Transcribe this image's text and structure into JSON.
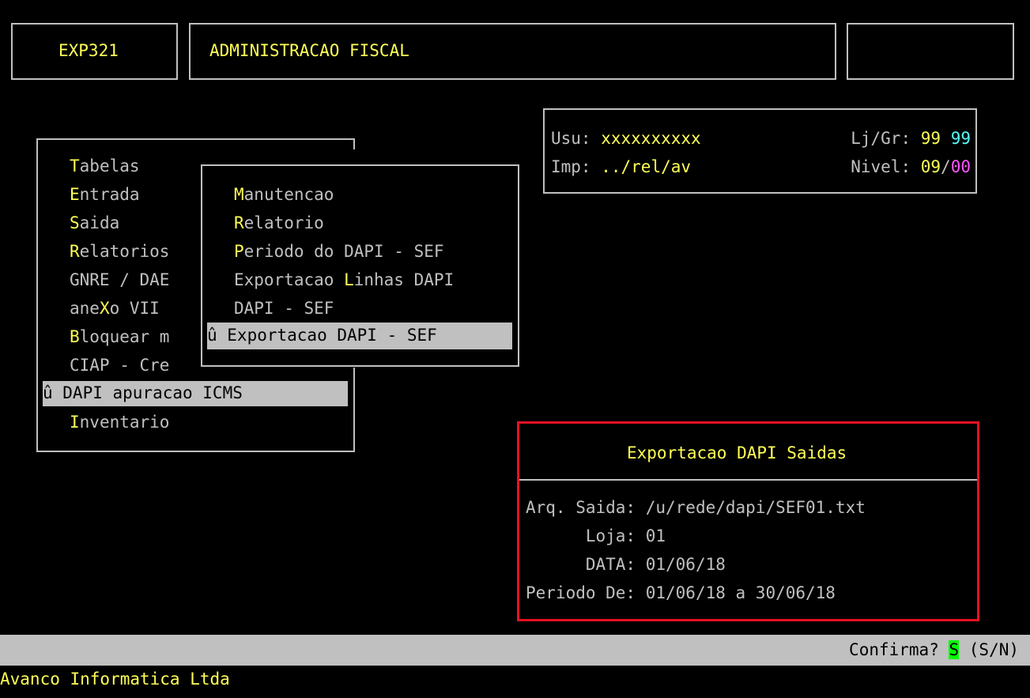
{
  "header": {
    "program_code": "EXP321",
    "title": "ADMINISTRACAO FISCAL",
    "right_box": ""
  },
  "user_info": {
    "usu_label": "Usu:",
    "usu_value": "xxxxxxxxxx",
    "lj_label": "Lj/Gr:",
    "lj_value": "99",
    "gr_value": "99",
    "imp_label": "Imp:",
    "imp_value": "../rel/av",
    "nivel_label": "Nivel:",
    "nivel_value_1": "09",
    "nivel_sep": "/",
    "nivel_value_2": "00"
  },
  "main_menu": {
    "items": [
      {
        "hot": "T",
        "rest": "abelas"
      },
      {
        "hot": "E",
        "rest": "ntrada"
      },
      {
        "hot": "S",
        "rest": "aida"
      },
      {
        "hot": "R",
        "rest": "elatorios"
      },
      {
        "pre": "GNRE / DAE",
        "hot": "",
        "rest": ""
      },
      {
        "pre": "ane",
        "hot": "X",
        "rest": "o VII"
      },
      {
        "hot": "B",
        "rest": "loquear m"
      },
      {
        "pre": "CIAP - Cre",
        "hot": "",
        "rest": ""
      },
      {
        "selected": true,
        "text": "û DAPI apuracao ICMS"
      },
      {
        "hot": "I",
        "rest": "nventario"
      }
    ]
  },
  "sub_menu": {
    "items": [
      {
        "hot": "M",
        "rest": "anutencao"
      },
      {
        "hot": "R",
        "rest": "elatorio"
      },
      {
        "hot": "P",
        "rest": "eriodo do DAPI - SEF"
      },
      {
        "pre": "Exportacao ",
        "hot": "L",
        "rest": "inhas DAPI"
      },
      {
        "pre": "DAPI - SEF",
        "hot": "",
        "rest": ""
      },
      {
        "selected": true,
        "text": "û Exportacao DAPI - SEF"
      }
    ]
  },
  "dialog": {
    "title": "Exportacao DAPI Saidas",
    "fields": [
      {
        "label": "Arq. Saida:",
        "value": "/u/rede/dapi/SEF01.txt"
      },
      {
        "label": "      Loja:",
        "value": "01"
      },
      {
        "label": "      DATA:",
        "value": "01/06/18"
      },
      {
        "label": "Periodo De:",
        "value": "01/06/18 a 30/06/18"
      }
    ],
    "border_color": "#e81123"
  },
  "status_bar": {
    "prompt": "Confirma? ",
    "answer": "S",
    "options": " (S/N)"
  },
  "footer": {
    "company": "Avanco Informatica Ltda"
  },
  "colors": {
    "background": "#000000",
    "text": "#c0c0c0",
    "highlight": "#ffff55",
    "cyan": "#55ffff",
    "magenta": "#ff55ff",
    "answer_bg": "#00ff00"
  }
}
